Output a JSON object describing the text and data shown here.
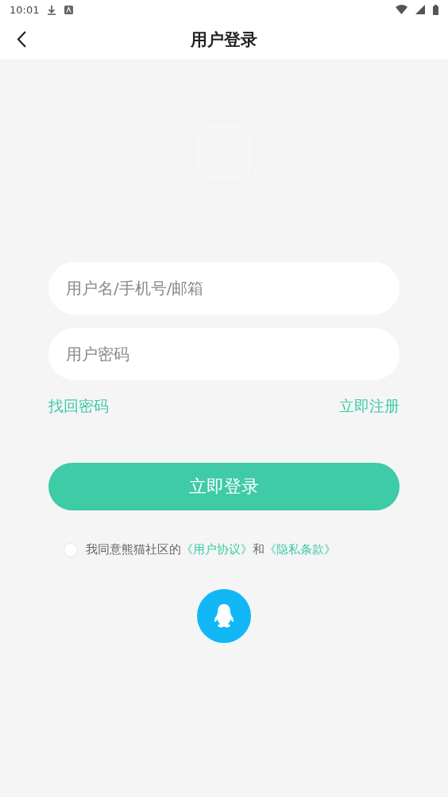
{
  "status_bar": {
    "time": "10:01"
  },
  "header": {
    "title": "用户登录"
  },
  "fields": [
    {
      "placeholder": "用户名/手机号/邮箱"
    },
    {
      "placeholder": "用户密码"
    }
  ],
  "links": [
    "找回密码",
    "立即注册"
  ],
  "login_button": "立即登录",
  "agreement": {
    "checked": false,
    "text": "我同意熊猫社区的",
    "link_1": "《用户协议》",
    "joiner": "和",
    "link_2": "《隐私条款》"
  }
}
